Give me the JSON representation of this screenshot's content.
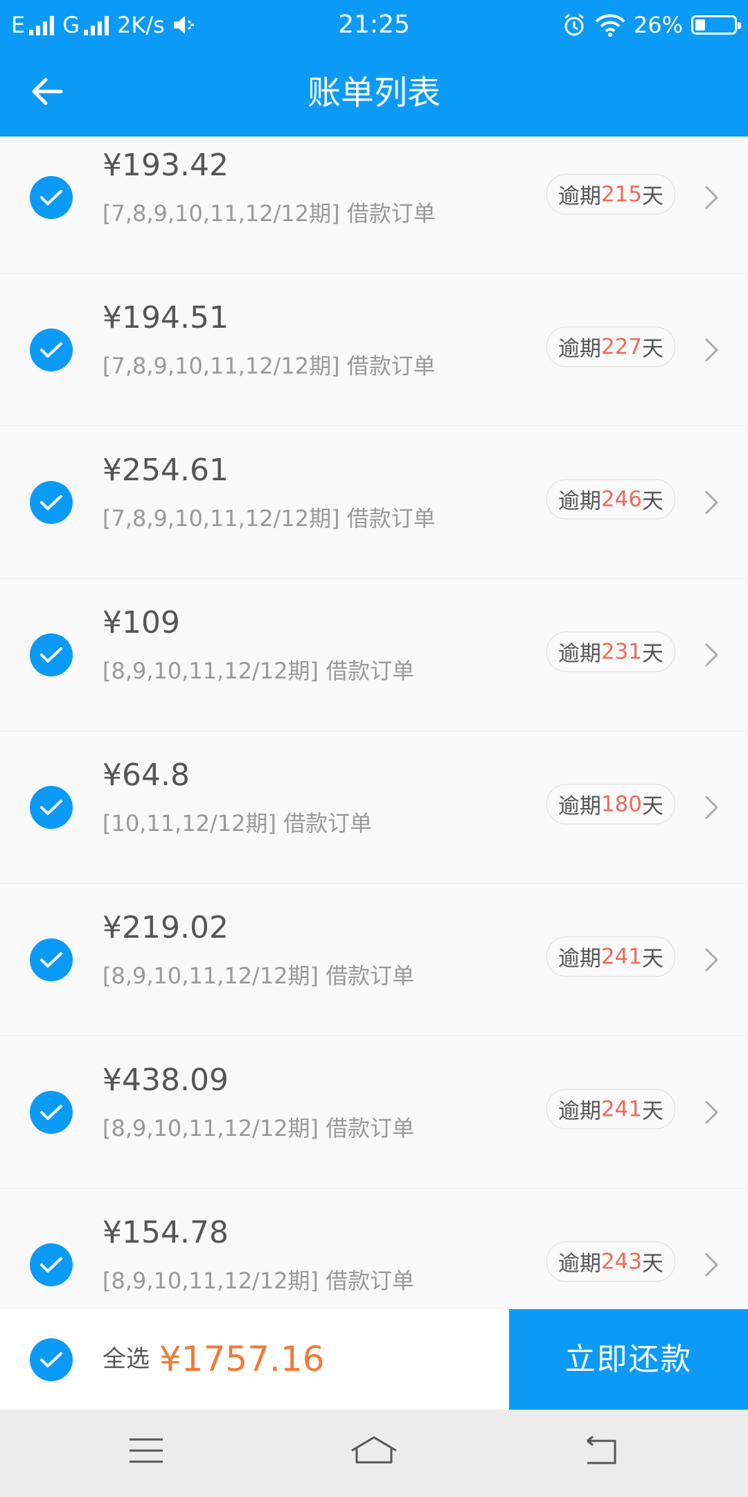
{
  "status_bar": {
    "left": [
      "E",
      "G",
      "2K/s"
    ],
    "time": "21:25",
    "battery_text": "26%",
    "battery_level": 0.26
  },
  "nav": {
    "title": "账单列表"
  },
  "items": [
    {
      "amount": "¥193.42",
      "periods": "[7,8,9,10,11,12/12期] 借款订单",
      "overdue_prefix": "逾期",
      "overdue_days": "215",
      "overdue_suffix": "天"
    },
    {
      "amount": "¥194.51",
      "periods": "[7,8,9,10,11,12/12期] 借款订单",
      "overdue_prefix": "逾期",
      "overdue_days": "227",
      "overdue_suffix": "天"
    },
    {
      "amount": "¥254.61",
      "periods": "[7,8,9,10,11,12/12期] 借款订单",
      "overdue_prefix": "逾期",
      "overdue_days": "246",
      "overdue_suffix": "天"
    },
    {
      "amount": "¥109",
      "periods": "[8,9,10,11,12/12期] 借款订单",
      "overdue_prefix": "逾期",
      "overdue_days": "231",
      "overdue_suffix": "天"
    },
    {
      "amount": "¥64.8",
      "periods": "[10,11,12/12期] 借款订单",
      "overdue_prefix": "逾期",
      "overdue_days": "180",
      "overdue_suffix": "天"
    },
    {
      "amount": "¥219.02",
      "periods": "[8,9,10,11,12/12期] 借款订单",
      "overdue_prefix": "逾期",
      "overdue_days": "241",
      "overdue_suffix": "天"
    },
    {
      "amount": "¥438.09",
      "periods": "[8,9,10,11,12/12期] 借款订单",
      "overdue_prefix": "逾期",
      "overdue_days": "241",
      "overdue_suffix": "天"
    },
    {
      "amount": "¥154.78",
      "periods": "[8,9,10,11,12/12期] 借款订单",
      "overdue_prefix": "逾期",
      "overdue_days": "243",
      "overdue_suffix": "天"
    }
  ],
  "footer": {
    "select_all_label": "全选",
    "total": "¥1757.16",
    "pay_button": "立即还款"
  },
  "colors": {
    "brand": "#0b9af6",
    "overdue": "#ef6b5a",
    "total": "#f07a38"
  }
}
